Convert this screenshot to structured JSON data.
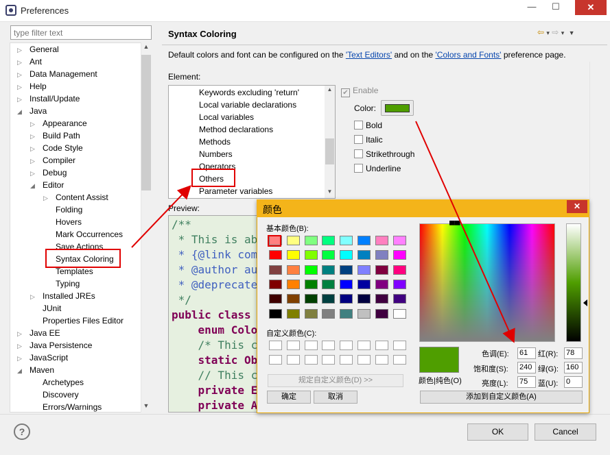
{
  "window": {
    "title": "Preferences",
    "close": "✕",
    "minimize": "—",
    "maximize": "☐"
  },
  "filter": {
    "placeholder": "type filter text"
  },
  "tree": [
    {
      "label": "General",
      "indent": 0,
      "twisty": "▷"
    },
    {
      "label": "Ant",
      "indent": 0,
      "twisty": "▷"
    },
    {
      "label": "Data Management",
      "indent": 0,
      "twisty": "▷"
    },
    {
      "label": "Help",
      "indent": 0,
      "twisty": "▷"
    },
    {
      "label": "Install/Update",
      "indent": 0,
      "twisty": "▷"
    },
    {
      "label": "Java",
      "indent": 0,
      "twisty": "◢"
    },
    {
      "label": "Appearance",
      "indent": 1,
      "twisty": "▷"
    },
    {
      "label": "Build Path",
      "indent": 1,
      "twisty": "▷"
    },
    {
      "label": "Code Style",
      "indent": 1,
      "twisty": "▷"
    },
    {
      "label": "Compiler",
      "indent": 1,
      "twisty": "▷"
    },
    {
      "label": "Debug",
      "indent": 1,
      "twisty": "▷"
    },
    {
      "label": "Editor",
      "indent": 1,
      "twisty": "◢"
    },
    {
      "label": "Content Assist",
      "indent": 2,
      "twisty": "▷"
    },
    {
      "label": "Folding",
      "indent": 2,
      "twisty": ""
    },
    {
      "label": "Hovers",
      "indent": 2,
      "twisty": ""
    },
    {
      "label": "Mark Occurrences",
      "indent": 2,
      "twisty": ""
    },
    {
      "label": "Save Actions",
      "indent": 2,
      "twisty": ""
    },
    {
      "label": "Syntax Coloring",
      "indent": 2,
      "twisty": ""
    },
    {
      "label": "Templates",
      "indent": 2,
      "twisty": ""
    },
    {
      "label": "Typing",
      "indent": 2,
      "twisty": ""
    },
    {
      "label": "Installed JREs",
      "indent": 1,
      "twisty": "▷"
    },
    {
      "label": "JUnit",
      "indent": 1,
      "twisty": ""
    },
    {
      "label": "Properties Files Editor",
      "indent": 1,
      "twisty": ""
    },
    {
      "label": "Java EE",
      "indent": 0,
      "twisty": "▷"
    },
    {
      "label": "Java Persistence",
      "indent": 0,
      "twisty": "▷"
    },
    {
      "label": "JavaScript",
      "indent": 0,
      "twisty": "▷"
    },
    {
      "label": "Maven",
      "indent": 0,
      "twisty": "◢"
    },
    {
      "label": "Archetypes",
      "indent": 1,
      "twisty": ""
    },
    {
      "label": "Discovery",
      "indent": 1,
      "twisty": ""
    },
    {
      "label": "Errors/Warnings",
      "indent": 1,
      "twisty": ""
    }
  ],
  "page": {
    "title": "Syntax Coloring",
    "description_before": "Default colors and font can be configured on the ",
    "link_text_editors": "'Text Editors'",
    "description_mid": " and on the ",
    "link_colors_fonts": "'Colors and Fonts'",
    "description_after": " preference page.",
    "element_label": "Element:",
    "preview_label": "Preview:",
    "enable_label": "Enable",
    "color_label": "Color:",
    "bold_label": "Bold",
    "italic_label": "Italic",
    "strikethrough_label": "Strikethrough",
    "underline_label": "Underline",
    "selected_color": "#4f9e00"
  },
  "elements": [
    "Keywords excluding 'return'",
    "Local variable declarations",
    "Local variables",
    "Method declarations",
    "Methods",
    "Numbers",
    "Operators",
    "Others",
    "Parameter variables"
  ],
  "preview_code": [
    {
      "cls": "cm",
      "text": "/**"
    },
    {
      "cls": "cm",
      "text": " * This is ab"
    },
    {
      "cls": "dc",
      "text": " * {@link com"
    },
    {
      "cls": "dc",
      "text": " * @author au"
    },
    {
      "cls": "dc",
      "text": " * @deprecate"
    },
    {
      "cls": "cm",
      "text": " */"
    },
    {
      "cls": "kw",
      "text": "public class "
    },
    {
      "cls": "kw",
      "text": "    enum Colo"
    },
    {
      "cls": "cm",
      "text": "    /* This c"
    },
    {
      "cls": "kw",
      "text": "    static Ob"
    },
    {
      "cls": "cm",
      "text": "    // This c"
    },
    {
      "cls": "kw",
      "text": "    private E"
    },
    {
      "cls": "kw",
      "text": "    private A"
    }
  ],
  "buttons": {
    "ok": "OK",
    "cancel": "Cancel",
    "help": "?"
  },
  "color_dialog": {
    "title": "颜色",
    "close": "✕",
    "basic_colors_label": "基本颜色(B):",
    "custom_colors_label": "自定义颜色(C):",
    "define_custom_button": "规定自定义颜色(D) >>",
    "ok_button": "确定",
    "cancel_button": "取消",
    "color_solid_label": "颜色|纯色(O)",
    "hue_label": "色调(E):",
    "hue_value": "61",
    "sat_label": "饱和度(S):",
    "sat_value": "240",
    "lum_label": "亮度(L):",
    "lum_value": "75",
    "red_label": "红(R):",
    "red_value": "78",
    "green_label": "绿(G):",
    "green_value": "160",
    "blue_label": "蓝(U):",
    "blue_value": "0",
    "add_custom_button": "添加到自定义颜色(A)",
    "basic_colors": [
      "#ff8080",
      "#ffff80",
      "#80ff80",
      "#00ff80",
      "#80ffff",
      "#0080ff",
      "#ff80c0",
      "#ff80ff",
      "#ff0000",
      "#ffff00",
      "#80ff00",
      "#00ff40",
      "#00ffff",
      "#0080c0",
      "#8080c0",
      "#ff00ff",
      "#804040",
      "#ff8040",
      "#00ff00",
      "#008080",
      "#004080",
      "#8080ff",
      "#800040",
      "#ff0080",
      "#800000",
      "#ff8000",
      "#008000",
      "#008040",
      "#0000ff",
      "#0000a0",
      "#800080",
      "#8000ff",
      "#400000",
      "#804000",
      "#004000",
      "#004040",
      "#000080",
      "#000040",
      "#400040",
      "#400080",
      "#000000",
      "#808000",
      "#808040",
      "#808080",
      "#408080",
      "#c0c0c0",
      "#400040",
      "#ffffff"
    ]
  }
}
